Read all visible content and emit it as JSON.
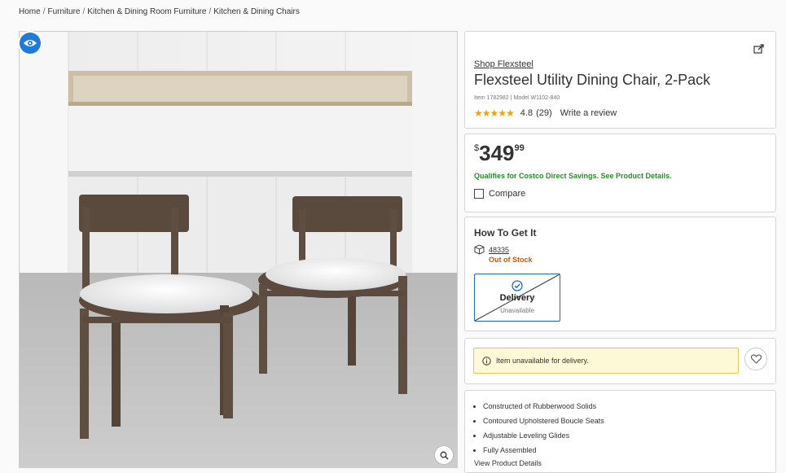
{
  "breadcrumb": [
    {
      "label": "Home"
    },
    {
      "label": "Furniture"
    },
    {
      "label": "Kitchen & Dining Room Furniture"
    },
    {
      "label": "Kitchen & Dining Chairs"
    }
  ],
  "breadcrumb_separator": "/",
  "product": {
    "shop_link": "Shop Flexsteel",
    "title": "Flexsteel Utility Dining Chair, 2-Pack",
    "item_line": "Item 1782982 | Model W1102-840",
    "rating_value": "4.8",
    "rating_count": "(29)",
    "write_review": "Write a review",
    "stars": "★★★★★"
  },
  "price": {
    "currency": "$",
    "dollars": "349",
    "cents": "99",
    "qualifies": "Qualifies for Costco Direct Savings. See Product Details.",
    "compare_label": "Compare"
  },
  "fulfillment": {
    "heading": "How To Get It",
    "zip": "48335",
    "stock_status": "Out of Stock",
    "delivery_label": "Delivery",
    "delivery_sub": "Unavailable"
  },
  "notice": {
    "text": "Item unavailable for delivery."
  },
  "features": [
    "Constructed of Rubberwood Solids",
    "Contoured Upholstered Boucle Seats",
    "Adjustable Leveling Glides",
    "Fully Assembled"
  ],
  "view_details": "View Product Details",
  "colors": {
    "accent_blue": "#1f7ad8",
    "success_green": "#2b8a2b",
    "warning_orange": "#d15600",
    "notice_bg": "#fdf9d6",
    "star_gold": "#f0a30a"
  },
  "icons": {
    "eye": "eye-icon",
    "zoom": "magnifier-icon",
    "share": "share-icon",
    "box": "box-icon",
    "check": "check-circle-icon",
    "info": "info-icon",
    "heart": "heart-icon"
  }
}
